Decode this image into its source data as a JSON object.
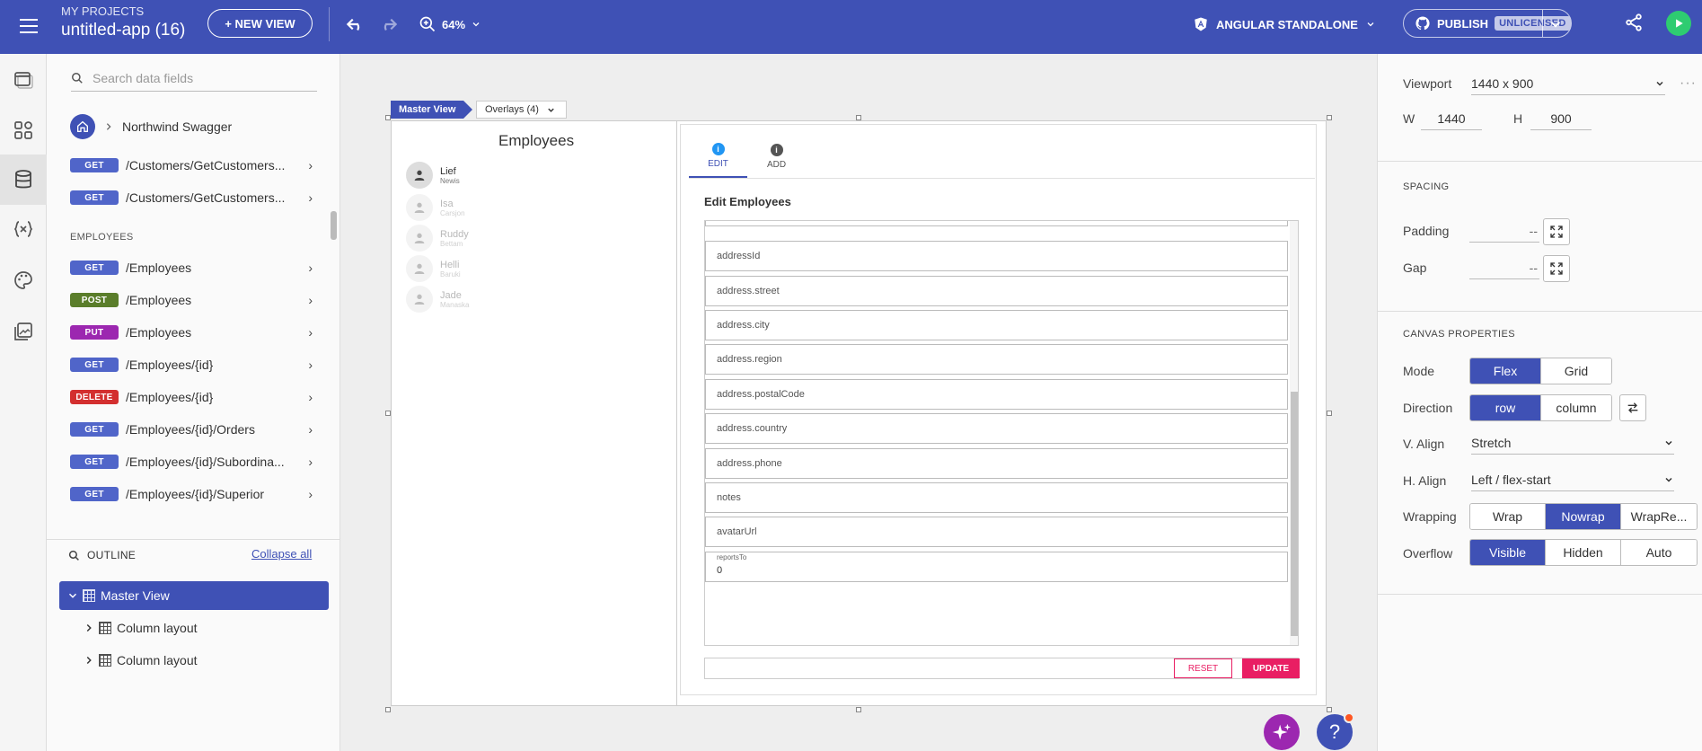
{
  "topbar": {
    "project_label": "MY PROJECTS",
    "project_name": "untitled-app (16)",
    "new_view": "+ NEW VIEW",
    "zoom": "64%",
    "framework": "ANGULAR STANDALONE",
    "publish": "PUBLISH",
    "license_badge": "UNLICENSED"
  },
  "datapanel": {
    "search_placeholder": "Search data fields",
    "breadcrumb": "Northwind Swagger",
    "customers": [
      {
        "method": "GET",
        "path": "/Customers/GetCustomers..."
      },
      {
        "method": "GET",
        "path": "/Customers/GetCustomers..."
      }
    ],
    "employees_label": "EMPLOYEES",
    "employees": [
      {
        "method": "GET",
        "path": "/Employees"
      },
      {
        "method": "POST",
        "path": "/Employees"
      },
      {
        "method": "PUT",
        "path": "/Employees"
      },
      {
        "method": "GET",
        "path": "/Employees/{id}"
      },
      {
        "method": "DELETE",
        "path": "/Employees/{id}"
      },
      {
        "method": "GET",
        "path": "/Employees/{id}/Orders"
      },
      {
        "method": "GET",
        "path": "/Employees/{id}/Subordina..."
      },
      {
        "method": "GET",
        "path": "/Employees/{id}/Superior"
      }
    ]
  },
  "outline": {
    "title": "OUTLINE",
    "collapse_all": "Collapse all",
    "items": [
      "Master View",
      "Column layout",
      "Column layout"
    ]
  },
  "canvas": {
    "master_tab": "Master View",
    "overlays_tab": "Overlays (4)",
    "employees_title": "Employees",
    "employees": [
      {
        "name": "Lief",
        "sub": "Newis"
      },
      {
        "name": "Isa",
        "sub": "Carsjon"
      },
      {
        "name": "Ruddy",
        "sub": "Bettam"
      },
      {
        "name": "Helli",
        "sub": "Baruki"
      },
      {
        "name": "Jade",
        "sub": "Manaska"
      }
    ],
    "tabs": [
      "EDIT",
      "ADD"
    ],
    "edit_title": "Edit Employees",
    "fields": [
      "addressId",
      "address.street",
      "address.city",
      "address.region",
      "address.postalCode",
      "address.country",
      "address.phone",
      "notes",
      "avatarUrl"
    ],
    "reports_to_label": "reportsTo",
    "reports_to_value": "0",
    "reset": "RESET",
    "update": "UPDATE"
  },
  "props": {
    "viewport_label": "Viewport",
    "viewport_value": "1440 x 900",
    "w_label": "W",
    "w_value": "1440",
    "h_label": "H",
    "h_value": "900",
    "spacing_title": "SPACING",
    "padding_label": "Padding",
    "padding_value": "--",
    "gap_label": "Gap",
    "gap_value": "--",
    "canvas_title": "CANVAS PROPERTIES",
    "mode_label": "Mode",
    "mode_options": [
      "Flex",
      "Grid"
    ],
    "direction_label": "Direction",
    "direction_options": [
      "row",
      "column"
    ],
    "valign_label": "V. Align",
    "valign_value": "Stretch",
    "halign_label": "H. Align",
    "halign_value": "Left / flex-start",
    "wrapping_label": "Wrapping",
    "wrapping_options": [
      "Wrap",
      "Nowrap",
      "WrapRe..."
    ],
    "overflow_label": "Overflow",
    "overflow_options": [
      "Visible",
      "Hidden",
      "Auto"
    ]
  }
}
